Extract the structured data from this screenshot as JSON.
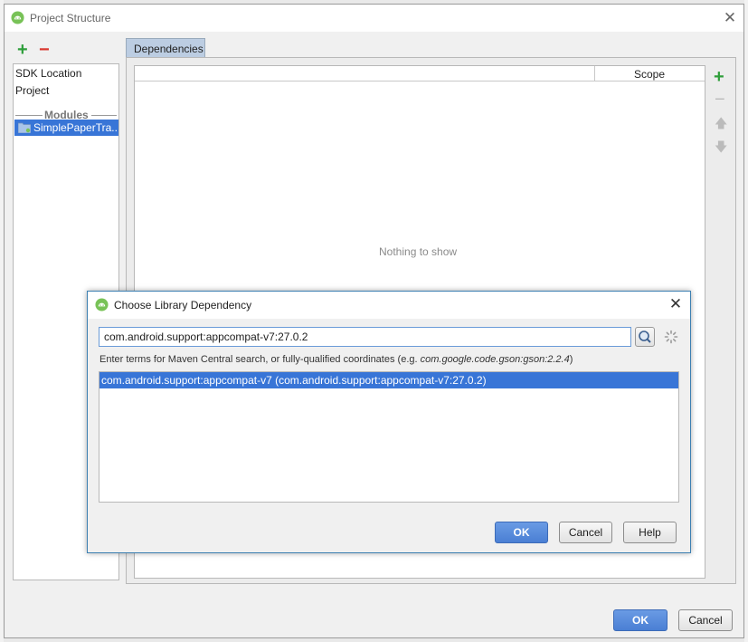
{
  "window": {
    "title": "Project Structure",
    "close_glyph": "✕"
  },
  "left_toolbar": {
    "add_glyph": "+",
    "remove_glyph": "−"
  },
  "left_list": {
    "items": [
      "SDK Location",
      "Project"
    ],
    "section_header": "Modules",
    "selected_module": "SimplePaperTra..."
  },
  "tabs": [
    {
      "label": "Dependencies"
    }
  ],
  "dependencies_table": {
    "columns": [
      "",
      "Scope"
    ],
    "empty_text": "Nothing to show",
    "toolbar": {
      "add_glyph": "+",
      "remove_glyph": "−",
      "up_glyph": "🡅",
      "down_glyph": "🡇"
    }
  },
  "footer": {
    "ok_label": "OK",
    "cancel_label": "Cancel"
  },
  "dialog": {
    "title": "Choose Library Dependency",
    "close_glyph": "✕",
    "search_value": "com.android.support:appcompat-v7:27.0.2",
    "hint_prefix": "Enter terms for Maven Central search, or fully-qualified coordinates (e.g. ",
    "hint_example": "com.google.code.gson:gson:2.2.4",
    "hint_suffix": ")",
    "results": [
      "com.android.support:appcompat-v7 (com.android.support:appcompat-v7:27.0.2)"
    ],
    "ok_label": "OK",
    "cancel_label": "Cancel",
    "help_label": "Help"
  },
  "colors": {
    "selection": "#3875d7",
    "primary_button": "#4a7fd4",
    "add_green": "#2e9e3a",
    "remove_red": "#d9352c",
    "android_green": "#78c257"
  },
  "icons": [
    "android-icon",
    "close-icon",
    "plus-icon",
    "minus-icon",
    "folder-icon",
    "arrow-up-icon",
    "arrow-down-icon",
    "search-icon",
    "spinner-icon"
  ]
}
